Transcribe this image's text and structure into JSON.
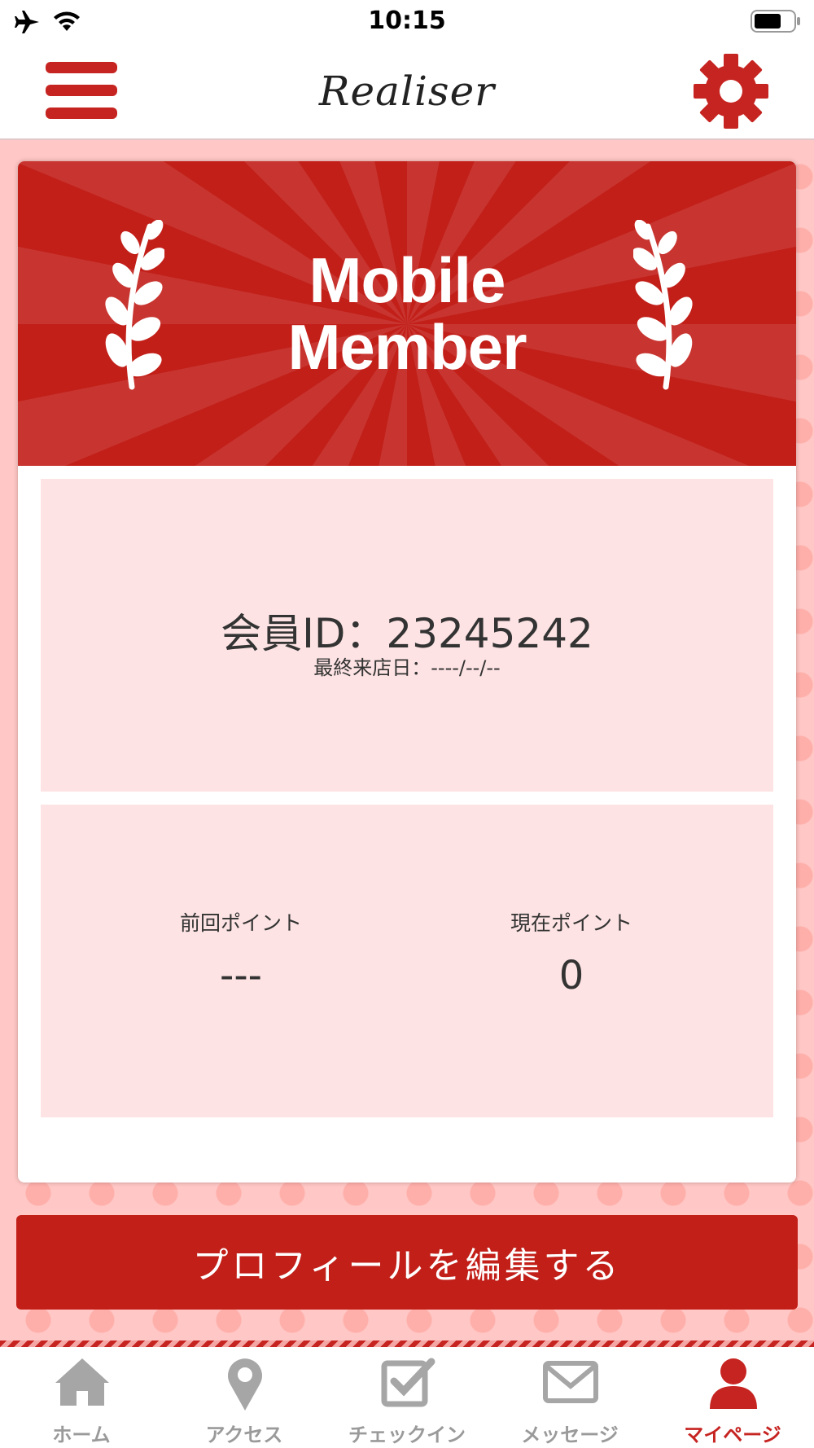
{
  "status_bar": {
    "time": "10:15",
    "icons": [
      "airplane-icon",
      "wifi-icon",
      "battery-icon"
    ]
  },
  "header": {
    "logo_text": "Realiser",
    "menu_icon": "hamburger-icon",
    "settings_icon": "gear-icon"
  },
  "banner": {
    "line1": "Mobile",
    "line2": "Member"
  },
  "member": {
    "id_label": "会員ID：23245242",
    "last_visit": "最終来店日：----/--/--"
  },
  "points": {
    "previous_label": "前回ポイント",
    "previous_value": "---",
    "current_label": "現在ポイント",
    "current_value": "0"
  },
  "edit_profile_label": "プロフィールを編集する",
  "tabs": [
    {
      "label": "ホーム",
      "icon": "home-icon",
      "active": false
    },
    {
      "label": "アクセス",
      "icon": "map-pin-icon",
      "active": false
    },
    {
      "label": "チェックイン",
      "icon": "checkbox-icon",
      "active": false
    },
    {
      "label": "メッセージ",
      "icon": "envelope-icon",
      "active": false
    },
    {
      "label": "マイページ",
      "icon": "user-icon",
      "active": true
    }
  ],
  "colors": {
    "accent": "#c21f19",
    "panel": "#fde3e3",
    "background": "#ffc7c5",
    "inactive_tab": "#9a9a9a"
  }
}
